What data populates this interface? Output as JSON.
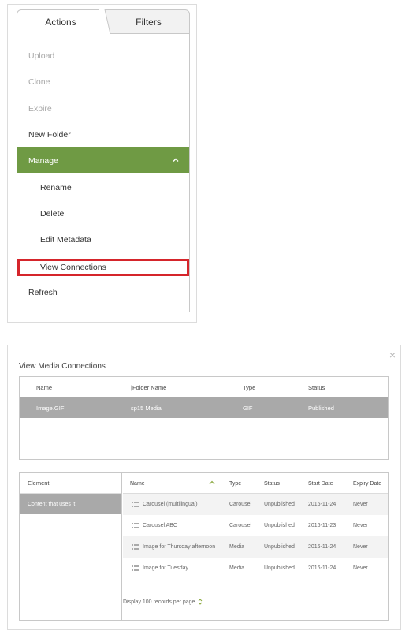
{
  "tabs": {
    "actions": "Actions",
    "filters": "Filters"
  },
  "menu": {
    "upload": "Upload",
    "clone": "Clone",
    "expire": "Expire",
    "new_folder": "New Folder",
    "manage": "Manage",
    "rename": "Rename",
    "delete": "Delete",
    "edit_metadata": "Edit Metadata",
    "view_connections": "View Connections",
    "refresh": "Refresh"
  },
  "colors": {
    "accent_green": "#6f9a44",
    "highlight_red": "#d5252b",
    "selected_row_gray": "#a9a9a9"
  },
  "dialog": {
    "title": "View Media Connections",
    "close_icon": "×",
    "table1": {
      "headers": {
        "name": "Name",
        "folder_name": "|Folder Name",
        "type": "Type",
        "status": "Status"
      },
      "row": {
        "name": "Image.GIF",
        "folder_name": "sp15 Media",
        "type": "GIF",
        "status": "Published"
      }
    },
    "table2": {
      "left_header": "Element",
      "left_row": "Content that uses it",
      "headers": {
        "name": "Name",
        "type": "Type",
        "status": "Status",
        "start_date": "Start Date",
        "expiry_date": "Expiry Date"
      },
      "rows": [
        {
          "name": "Carousel (multilingual)",
          "type": "Carousel",
          "status": "Unpublished",
          "start_date": "2016-11-24",
          "expiry_date": "Never"
        },
        {
          "name": "Carousel ABC",
          "type": "Carousel",
          "status": "Unpublished",
          "start_date": "2016-11-23",
          "expiry_date": "Never"
        },
        {
          "name": "Image for Thursday afternoon",
          "type": "Media",
          "status": "Unpublished",
          "start_date": "2016-11-24",
          "expiry_date": "Never"
        },
        {
          "name": "Image for Tuesday",
          "type": "Media",
          "status": "Unpublished",
          "start_date": "2016-11-24",
          "expiry_date": "Never"
        }
      ],
      "footer": "Display 100 records per page"
    }
  }
}
